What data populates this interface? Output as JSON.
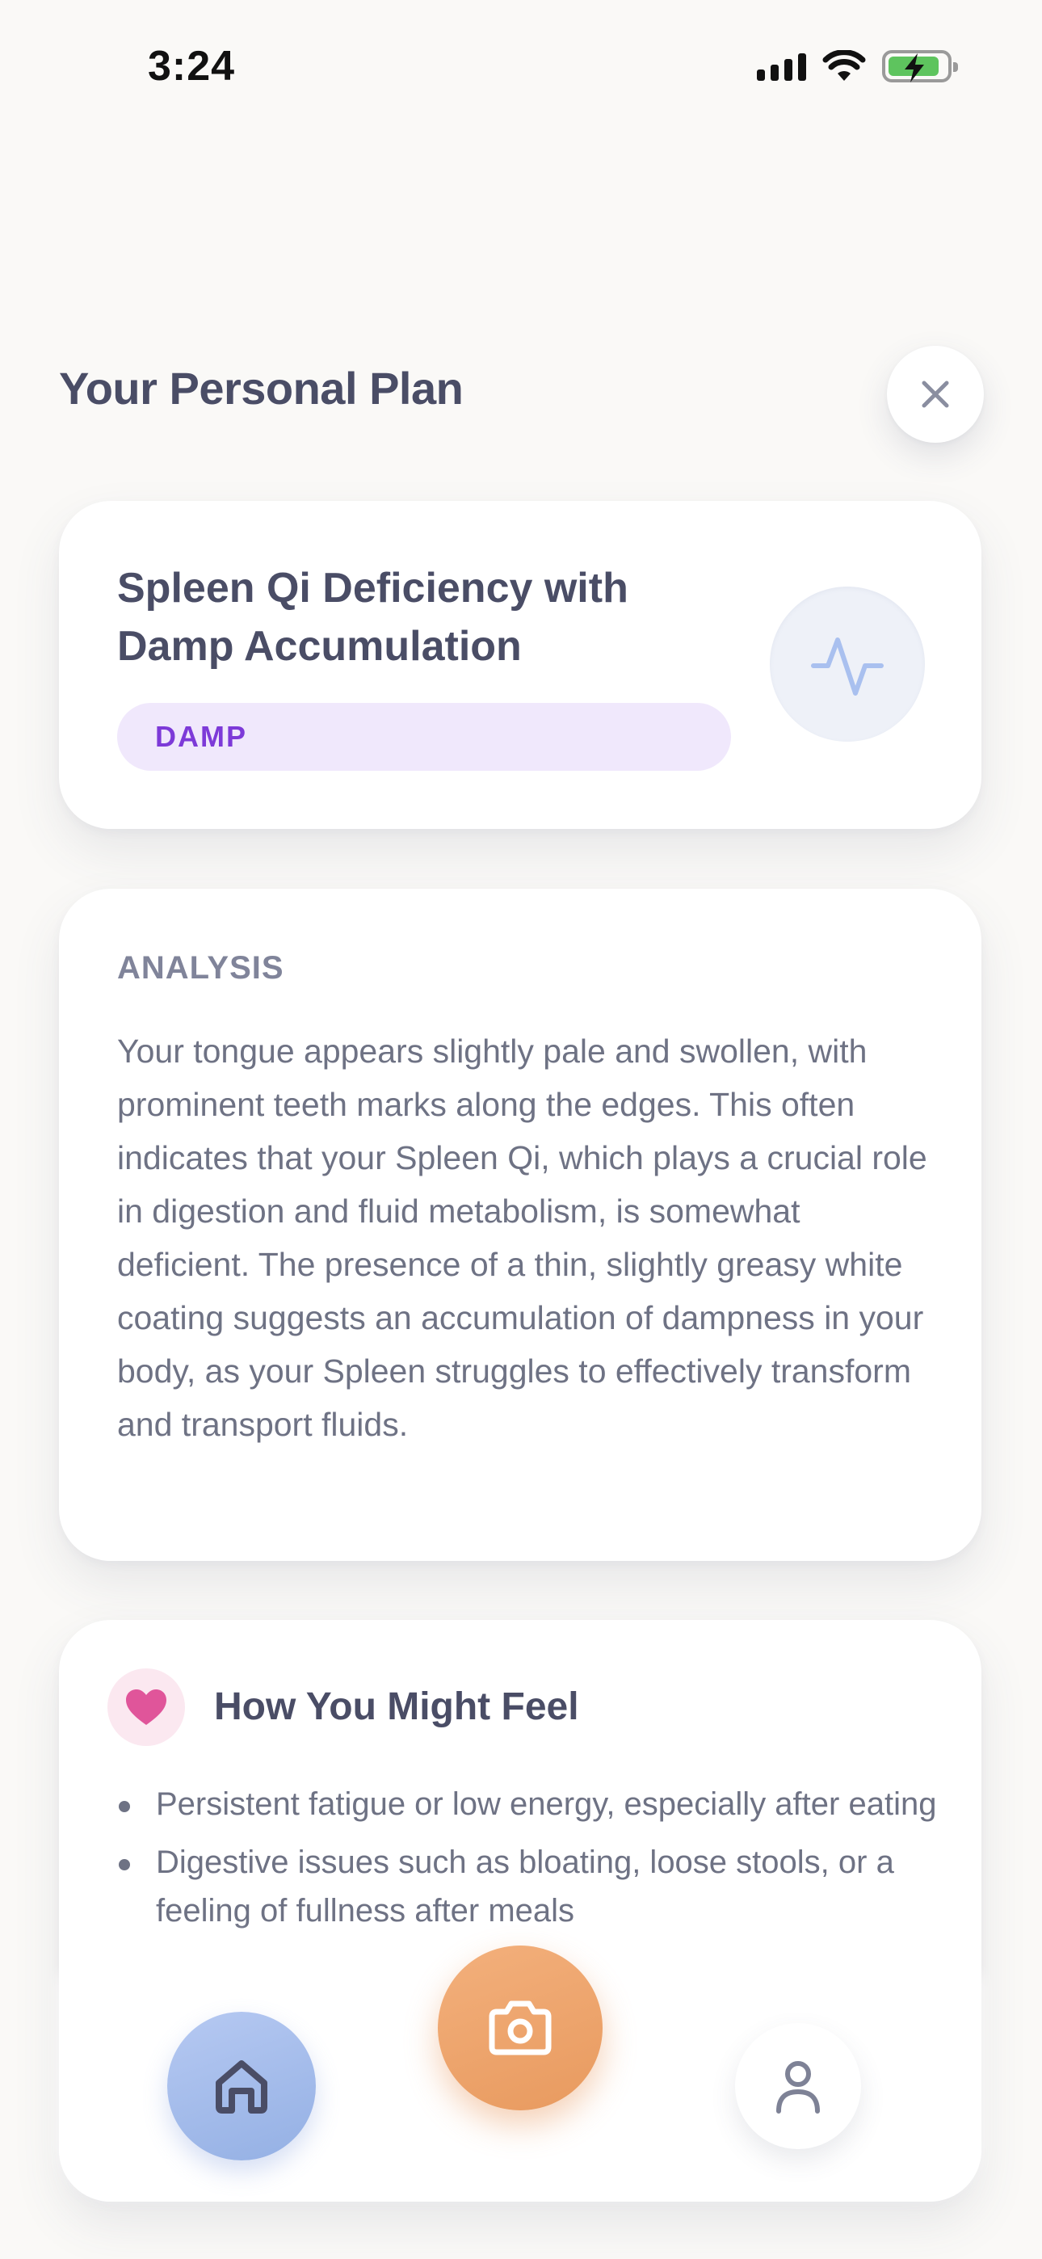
{
  "status_bar": {
    "time": "3:24"
  },
  "header": {
    "title": "Your Personal Plan"
  },
  "diagnosis": {
    "title": "Spleen Qi Deficiency with Damp Accumulation",
    "tag": "DAMP",
    "icon": "pulse-icon"
  },
  "analysis": {
    "label": "ANALYSIS",
    "text": "Your tongue appears slightly pale and swollen, with prominent teeth marks along the edges. This often indicates that your Spleen Qi, which plays a crucial role in digestion and fluid metabolism, is somewhat deficient. The presence of a thin, slightly greasy white coating suggests an accumulation of dampness in your body, as your Spleen struggles to effectively transform and transport fluids."
  },
  "feel": {
    "title": "How You Might Feel",
    "icon": "heart-icon",
    "items": [
      "Persistent fatigue or low energy, especially after eating",
      "Digestive issues such as bloating, loose stools, or a feeling of fullness after meals"
    ]
  },
  "nav": {
    "home_icon": "home-icon",
    "camera_icon": "camera-icon",
    "profile_icon": "profile-icon"
  },
  "colors": {
    "background": "#faf9f7",
    "tag_bg": "#f0e8fc",
    "tag_text": "#7d3ad8",
    "home": "#a8bdea",
    "camera": "#eea36b",
    "heart": "#e0559a"
  }
}
